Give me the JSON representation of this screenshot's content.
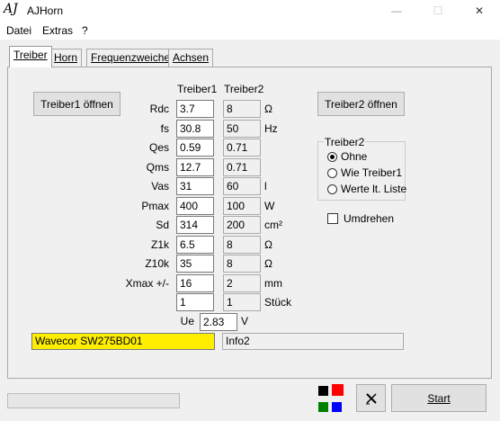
{
  "window": {
    "icon_text": "AJ",
    "title": "AJHorn",
    "minimize": "—",
    "maximize": "☐",
    "close": "✕"
  },
  "menu": [
    "Datei",
    "Extras",
    "?"
  ],
  "tabs": [
    "Treiber",
    "Horn",
    "Frequenzweiche",
    "Achsen"
  ],
  "buttons": {
    "open_driver1": "Treiber1 öffnen",
    "open_driver2": "Treiber2 öffnen",
    "start": "Start"
  },
  "columns": {
    "driver1": "Treiber1",
    "driver2": "Treiber2"
  },
  "params": [
    {
      "label": "Rdc",
      "d1": "3.7",
      "d2": "8",
      "unit": "Ω"
    },
    {
      "label": "fs",
      "d1": "30.8",
      "d2": "50",
      "unit": "Hz"
    },
    {
      "label": "Qes",
      "d1": "0.59",
      "d2": "0.71",
      "unit": ""
    },
    {
      "label": "Qms",
      "d1": "12.7",
      "d2": "0.71",
      "unit": ""
    },
    {
      "label": "Vas",
      "d1": "31",
      "d2": "60",
      "unit": "l"
    },
    {
      "label": "Pmax",
      "d1": "400",
      "d2": "100",
      "unit": "W"
    },
    {
      "label": "Sd",
      "d1": "314",
      "d2": "200",
      "unit": "cm²"
    },
    {
      "label": "Z1k",
      "d1": "6.5",
      "d2": "8",
      "unit": "Ω"
    },
    {
      "label": "Z10k",
      "d1": "35",
      "d2": "8",
      "unit": "Ω"
    },
    {
      "label": "Xmax +/-",
      "d1": "16",
      "d2": "2",
      "unit": "mm"
    },
    {
      "label": "",
      "d1": "1",
      "d2": "1",
      "unit": "Stück"
    }
  ],
  "ue": {
    "label": "Ue",
    "value": "2.83",
    "unit": "V"
  },
  "driver2_group": {
    "title": "Treiber2",
    "options": [
      "Ohne",
      "Wie Treiber1",
      "Werte lt. Liste"
    ],
    "selected_index": 0
  },
  "umdrehen": {
    "label": "Umdrehen",
    "checked": false
  },
  "info1": "Wavecor SW275BD01",
  "info2": "Info2",
  "info1_color": "#ffee00",
  "swatch_colors": [
    "#000000",
    "#ff0000",
    "#008000",
    "#0000ff"
  ],
  "icons": {
    "tool_button": "cross-tool-icon"
  }
}
